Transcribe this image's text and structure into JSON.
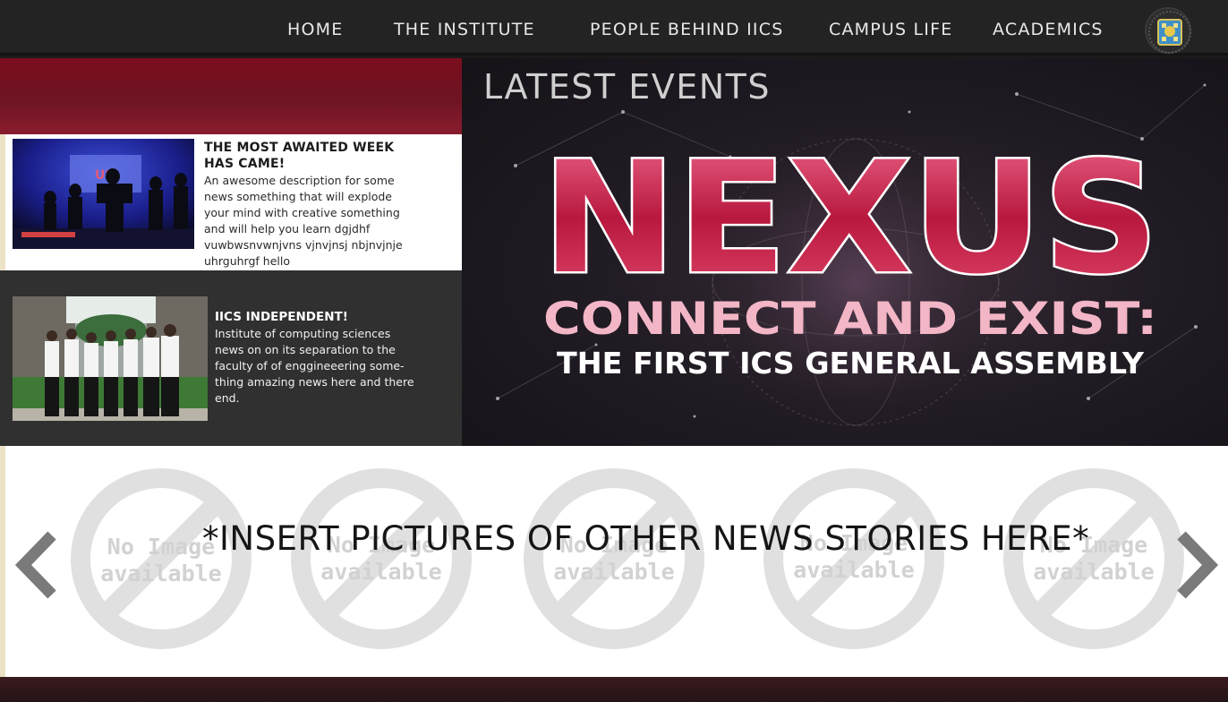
{
  "nav": {
    "items": [
      {
        "label": "HOME"
      },
      {
        "label": "THE INSTITUTE"
      },
      {
        "label": "PEOPLE BEHIND IICS"
      },
      {
        "label": "CAMPUS LIFE"
      },
      {
        "label": "ACADEMICS"
      }
    ],
    "seal_icon": "university-seal-icon"
  },
  "news": [
    {
      "title": "THE MOST AWAITED WEEK HAS CAME!",
      "description": "An awesome description for some news something that will explode your mind with creative something and will help you learn dgjdhf vuwbwsnvwnjvns vjnvjnsj nbjnvjnje uhrguhrgf hello"
    },
    {
      "title": "IICS INDEPENDENT!",
      "description": "Institute of computing sciences news on on its separation to the faculty of of enggineeering some-thing amazing news here and there end."
    }
  ],
  "hero": {
    "heading": "LATEST EVENTS",
    "banner_title": "NEXUS",
    "banner_line1": "CONNECT AND EXIST:",
    "banner_line2": "THE FIRST ICS GENERAL ASSEMBLY"
  },
  "carousel": {
    "placeholder_text": "*INSERT PICTURES OF OTHER NEWS STORIES HERE*",
    "items": [
      {
        "line1": "No Image",
        "line2": "available"
      },
      {
        "line1": "No Image",
        "line2": "available"
      },
      {
        "line1": "No Image",
        "line2": "available"
      },
      {
        "line1": "No Image",
        "line2": "available"
      },
      {
        "line1": "No Image",
        "line2": "available"
      }
    ],
    "prev_icon": "chevron-left-icon",
    "next_icon": "chevron-right-icon"
  },
  "colors": {
    "nav_bg": "#232323",
    "accent_maroon": "#7a0d1d",
    "nexus_pink": "#e0406a",
    "dark_panel": "#303030"
  }
}
